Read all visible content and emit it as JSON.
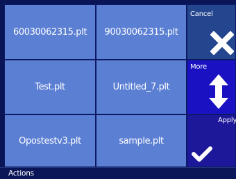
{
  "files": [
    {
      "name": "60030062315.plt"
    },
    {
      "name": "90030062315.plt"
    },
    {
      "name": "Test.plt"
    },
    {
      "name": "Untitled_7.plt"
    },
    {
      "name": "Opostestv3.plt"
    },
    {
      "name": "sample.plt"
    }
  ],
  "side_buttons": {
    "cancel": {
      "label": "Cancel",
      "icon": "close-icon"
    },
    "more": {
      "label": "More",
      "icon": "up-down-arrow-icon"
    },
    "apply": {
      "label": "Apply",
      "icon": "checkmark-icon"
    }
  },
  "footer": {
    "label": "Actions"
  },
  "colors": {
    "background": "#0a1557",
    "tile": "#5b7fd3",
    "cancel": "#24468e",
    "more": "#1a12c2",
    "apply": "#1d189a"
  }
}
